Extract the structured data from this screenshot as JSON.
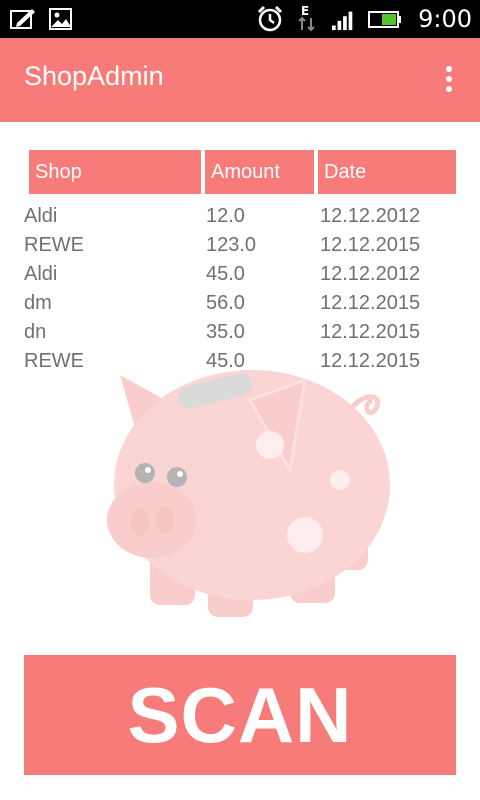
{
  "status_bar": {
    "time": "9:00",
    "icons": [
      "edit-icon",
      "image-icon",
      "alarm-icon",
      "data-e-icon",
      "signal-icon",
      "battery-icon"
    ]
  },
  "app_bar": {
    "title": "ShopAdmin",
    "overflow_icon": "more-vert-icon"
  },
  "table": {
    "headers": [
      "Shop",
      "Amount",
      "Date"
    ],
    "rows": [
      {
        "shop": "Aldi",
        "amount": "12.0",
        "date": "12.12.2012"
      },
      {
        "shop": "REWE",
        "amount": "123.0",
        "date": "12.12.2015"
      },
      {
        "shop": "Aldi",
        "amount": "45.0",
        "date": "12.12.2012"
      },
      {
        "shop": "dm",
        "amount": "56.0",
        "date": "12.12.2015"
      },
      {
        "shop": "dn",
        "amount": "35.0",
        "date": "12.12.2015"
      },
      {
        "shop": "REWE",
        "amount": "45.0",
        "date": "12.12.2015"
      }
    ]
  },
  "illustration": "piggy-bank",
  "scan_button": {
    "label": "SCAN"
  },
  "colors": {
    "accent": "#f77b78",
    "status_bar": "#000000",
    "text": "#707070"
  }
}
